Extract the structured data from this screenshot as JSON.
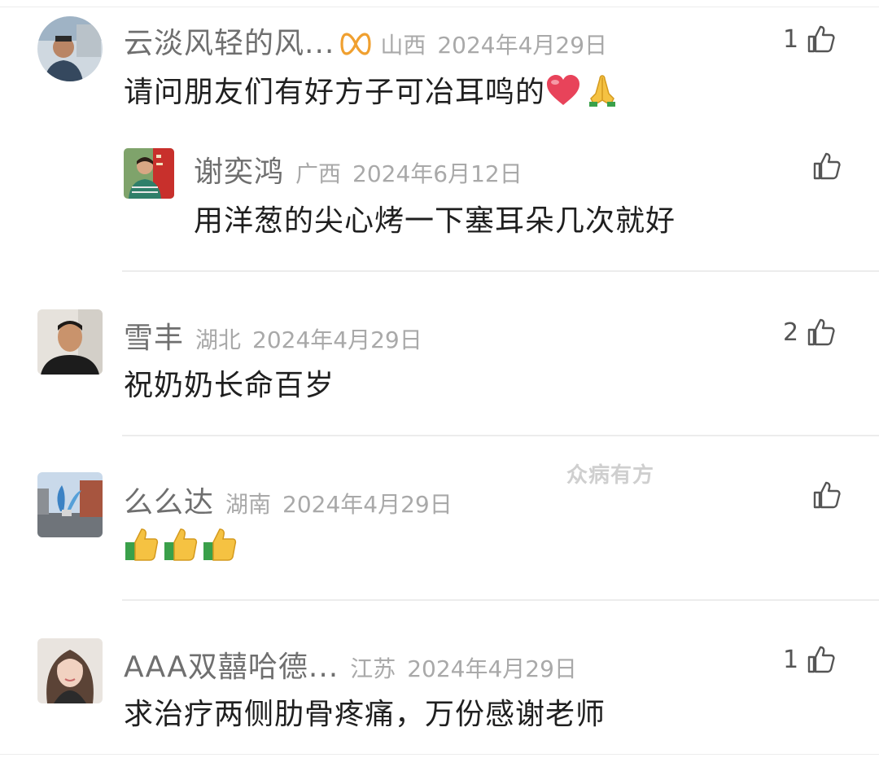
{
  "watermark": "众病有方",
  "colors": {
    "username": "#6f6f6f",
    "meta": "#a9a9a9",
    "text": "#1f1f1f",
    "badge": "#f0a030",
    "heart": "#e8435a"
  },
  "comments": [
    {
      "username": "云淡风轻的风...",
      "badge_icon": "vip-infinity-badge",
      "location": "山西",
      "date": "2024年4月29日",
      "text": "请问朋友们有好方子可冶耳鸣的",
      "emojis": [
        "heart-emoji",
        "folded-hands-emoji"
      ],
      "likes": "1",
      "replies": [
        {
          "username": "谢奕鸿",
          "location": "广西",
          "date": "2024年6月12日",
          "text": "用洋葱的尖心烤一下塞耳朵几次就好",
          "likes": ""
        }
      ]
    },
    {
      "username": "雪丰",
      "location": "湖北",
      "date": "2024年4月29日",
      "text": "祝奶奶长命百岁",
      "likes": "2"
    },
    {
      "username": "么么达",
      "location": "湖南",
      "date": "2024年4月29日",
      "text": "",
      "emojis": [
        "thumbs-up-emoji",
        "thumbs-up-emoji",
        "thumbs-up-emoji"
      ],
      "likes": ""
    },
    {
      "username": "AAA双囍哈德...",
      "location": "江苏",
      "date": "2024年4月29日",
      "text": "求治疗两侧肋骨疼痛，万份感谢老师",
      "likes": "1"
    }
  ]
}
